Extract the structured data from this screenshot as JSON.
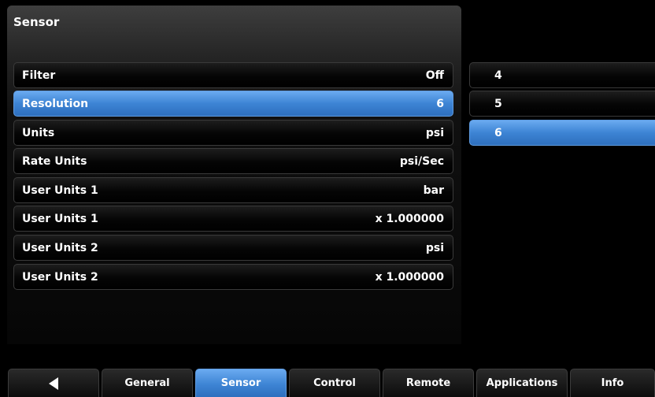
{
  "panel": {
    "title": "Sensor"
  },
  "settings": [
    {
      "label": "Filter",
      "value": "Off"
    },
    {
      "label": "Resolution",
      "value": "6"
    },
    {
      "label": "Units",
      "value": "psi"
    },
    {
      "label": "Rate Units",
      "value": "psi/Sec"
    },
    {
      "label": "User Units 1",
      "value": "bar"
    },
    {
      "label": "User Units 1",
      "value": "x 1.000000"
    },
    {
      "label": "User Units 2",
      "value": "psi"
    },
    {
      "label": "User Units 2",
      "value": "x 1.000000"
    }
  ],
  "selected_setting": "Resolution",
  "options": [
    "4",
    "5",
    "6"
  ],
  "selected_option": "6",
  "tabs": {
    "back_icon": "back-arrow-icon",
    "items": [
      "General",
      "Sensor",
      "Control",
      "Remote",
      "Applications",
      "Info"
    ],
    "active": "Sensor"
  },
  "colors": {
    "accent": "#3d84d4",
    "background": "#000000"
  }
}
